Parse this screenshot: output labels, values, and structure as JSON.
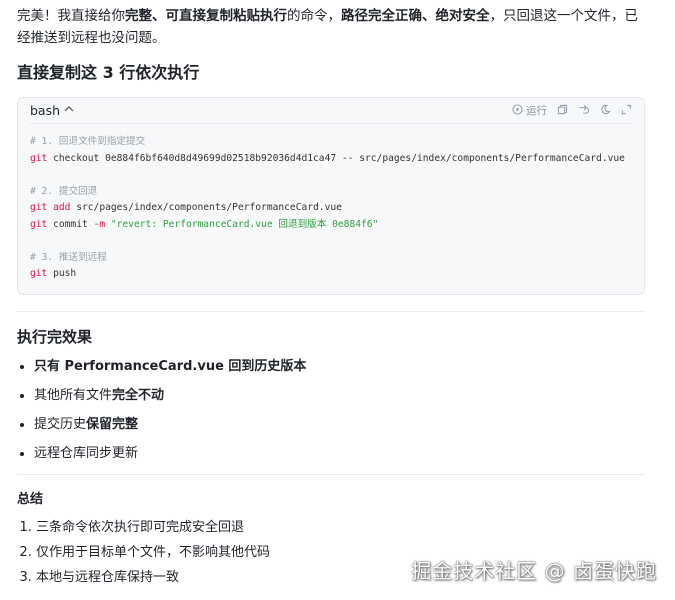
{
  "intro": {
    "p1": "完美！我直接给你",
    "b1": "完整、可直接复制粘贴执行",
    "p2": "的命令，",
    "b2": "路径完全正确、绝对安全",
    "p3": "，只回退这一个文件，已经推送到远程也没问题。"
  },
  "heading_copy": "直接复制这 3 行依次执行",
  "code": {
    "lang": "bash",
    "run_label": "运行",
    "icons": [
      "run-icon",
      "copy-icon",
      "wrap-icon",
      "theme-icon",
      "expand-icon"
    ],
    "c1": "# 1. 回退文件到指定提交",
    "l1_cmd": "git",
    "l1_rest": " checkout 0e884f6bf640d8d49699d02518b92036d4d1ca47 -- src/pages/index/components/PerformanceCard.vue",
    "c2": "# 2. 提交回退",
    "l2_cmd": "git",
    "l2_kw": " add",
    "l2_rest": " src/pages/index/components/PerformanceCard.vue",
    "l3_cmd": "git",
    "l3_rest1": " commit ",
    "l3_flag": "-m",
    "l3_str": " \"revert: PerformanceCard.vue 回退到版本 0e884f6\"",
    "c3": "# 3. 推送到远程",
    "l4_cmd": "git",
    "l4_rest": " push"
  },
  "heading_effect": "执行完效果",
  "effects": [
    {
      "pre": "",
      "bold": "只有 PerformanceCard.vue 回到历史版本",
      "post": ""
    },
    {
      "pre": "其他所有文件",
      "bold": "完全不动",
      "post": ""
    },
    {
      "pre": "提交历史",
      "bold": "保留完整",
      "post": ""
    },
    {
      "pre": "远程仓库同步更新",
      "bold": "",
      "post": ""
    }
  ],
  "heading_summary": "总结",
  "summary": [
    "三条命令依次执行即可完成安全回退",
    "仅作用于目标单个文件，不影响其他代码",
    "本地与远程仓库保持一致"
  ],
  "watermark": "掘金技术社区 @ 卤蛋快跑",
  "colors": {
    "comment": "#9aa0a6",
    "keyword": "#d14",
    "string": "#2f9e44",
    "code_bg": "#f7f8fa"
  }
}
